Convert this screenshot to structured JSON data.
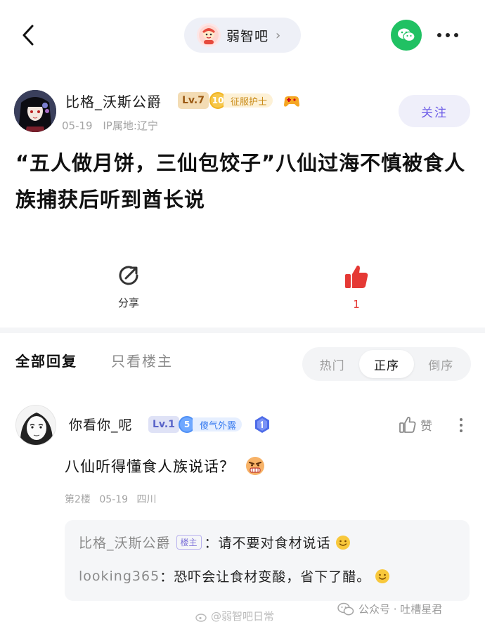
{
  "topbar": {
    "forum_name": "弱智吧",
    "forum_chevron": "›"
  },
  "icons": {
    "back": "chevron-left-icon",
    "wechat": "wechat-icon",
    "more": "more-icon"
  },
  "author": {
    "name": "比格_沃斯公爵",
    "level": "Lv.7",
    "honor_level": "10",
    "honor_title": "征服护士",
    "date": "05-19",
    "ip_location": "IP属地:辽宁",
    "follow_label": "关注"
  },
  "post": {
    "title": "“五人做月饼，三仙包饺子”八仙过海不慎被食人族捕获后听到酋长说"
  },
  "actions": {
    "share_label": "分享",
    "like_count": "1"
  },
  "reply_tabs": {
    "all": "全部回复",
    "owner_only": "只看楼主",
    "sort": [
      "热门",
      "正序",
      "倒序"
    ],
    "sort_active": "正序"
  },
  "reply": {
    "name": "你看你_呢",
    "level": "Lv.1",
    "honor_level": "5",
    "honor_title": "傻气外露",
    "like_label": "赞",
    "text": "八仙听得懂食人族说话？",
    "floor": "第2楼",
    "date": "05-19",
    "location": "四川",
    "sub_replies": [
      {
        "user": "比格_沃斯公爵",
        "tag": "楼主",
        "text": "：请不要对食材说话"
      },
      {
        "user": "looking365",
        "text": "：恐吓会让食材变酸，省下了醋。"
      }
    ]
  },
  "watermark": {
    "center": "@弱智吧日常",
    "right": "公众号 · 吐槽星君"
  },
  "colors": {
    "accent": "#6c5ce7",
    "like_red": "#e53935",
    "wechat_green": "#20c163"
  }
}
